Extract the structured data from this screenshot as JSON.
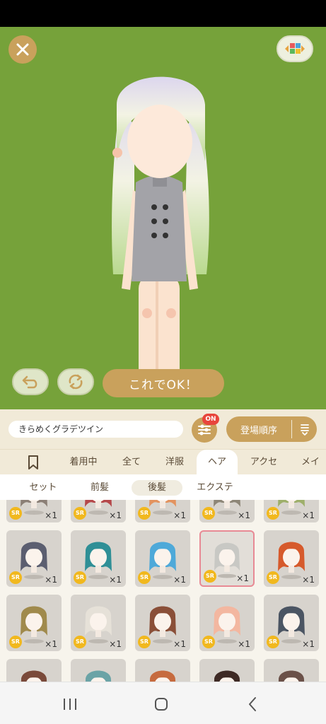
{
  "item_name_field": {
    "value": "きらめくグラデツイン"
  },
  "buttons": {
    "ok_label": "これでOK！",
    "sort_label": "登場順序",
    "filter_badge": "ON"
  },
  "tabs": [
    {
      "label": "着用中"
    },
    {
      "label": "全て"
    },
    {
      "label": "洋服"
    },
    {
      "label": "ヘア"
    },
    {
      "label": "アクセ"
    },
    {
      "label": "メイク"
    }
  ],
  "subtabs": [
    {
      "label": "セット"
    },
    {
      "label": "前髪"
    },
    {
      "label": "後髪"
    },
    {
      "label": "エクステ"
    }
  ],
  "active_tab": "ヘア",
  "items": [
    {
      "rarity": "SR",
      "qty": "×1",
      "hair": "#8b7f76"
    },
    {
      "rarity": "SR",
      "qty": "×1",
      "hair": "#b5484a"
    },
    {
      "rarity": "SR",
      "qty": "×1",
      "hair": "#e3935f"
    },
    {
      "rarity": "SR",
      "qty": "×1",
      "hair": "#8d8677"
    },
    {
      "rarity": "SR",
      "qty": "×1",
      "hair": "#9eaf6a"
    },
    {
      "rarity": "SR",
      "qty": "×1",
      "hair": "#5b5e70"
    },
    {
      "rarity": "SR",
      "qty": "×1",
      "hair": "#2f8f96"
    },
    {
      "rarity": "SR",
      "qty": "×1",
      "hair": "#4ea9d9"
    },
    {
      "rarity": "SR",
      "qty": "×1",
      "hair": "#c8c8c4"
    },
    {
      "rarity": "SR",
      "qty": "×1",
      "hair": "#d65a2c"
    },
    {
      "rarity": "SR",
      "qty": "×1",
      "hair": "#a08a4c"
    },
    {
      "rarity": "SR",
      "qty": "×1",
      "hair": "#e6e1d8"
    },
    {
      "rarity": "SR",
      "qty": "×1",
      "hair": "#8a4f38"
    },
    {
      "rarity": "SR",
      "qty": "×1",
      "hair": "#f3b7a0"
    },
    {
      "rarity": "SR",
      "qty": "×1",
      "hair": "#4b5563"
    },
    {
      "rarity": "",
      "qty": "",
      "hair": "#7a4a3a"
    },
    {
      "rarity": "",
      "qty": "",
      "hair": "#6aa3a6"
    },
    {
      "rarity": "",
      "qty": "",
      "hair": "#c66b3f"
    },
    {
      "rarity": "",
      "qty": "",
      "hair": "#3e2a25"
    },
    {
      "rarity": "",
      "qty": "",
      "hair": "#6b5149"
    }
  ],
  "colors": {
    "stage_bg": "#76a23a",
    "accent_gold": "#c9a15c",
    "badge_red": "#e8453c",
    "sr_gold": "#f1b81e",
    "selected_border": "#e88a95"
  },
  "icons": {
    "close": "close-icon",
    "layout": "grid-layout-icon",
    "undo": "undo-icon",
    "rotate": "rotate-icon",
    "filter": "sliders-icon",
    "sort": "sort-order-icon",
    "bookmark": "bookmark-icon"
  }
}
